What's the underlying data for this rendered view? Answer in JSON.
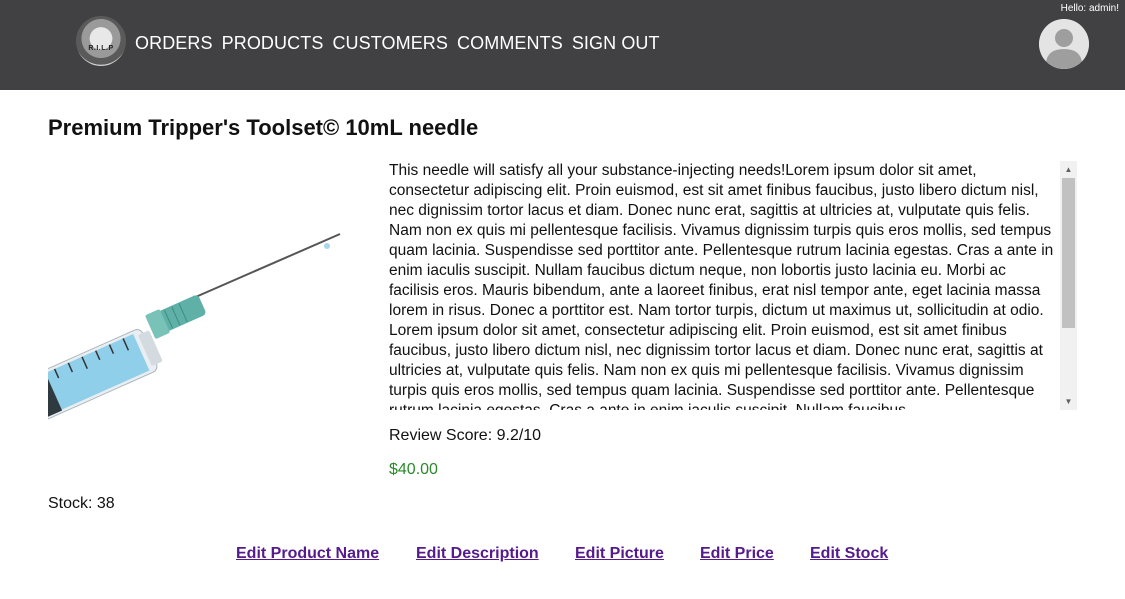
{
  "nav": {
    "logo_text": "R.I.L.P",
    "links": [
      "ORDERS",
      "PRODUCTS",
      "CUSTOMERS",
      "COMMENTS",
      "SIGN OUT"
    ],
    "greeting": "Hello: admin!"
  },
  "product": {
    "title": "Premium Tripper's Toolset© 10mL needle",
    "image_alt": "syringe-needle",
    "description": "This needle will satisfy all your substance-injecting needs!Lorem ipsum dolor sit amet, consectetur adipiscing elit. Proin euismod, est sit amet finibus faucibus, justo libero dictum nisl, nec dignissim tortor lacus et diam. Donec nunc erat, sagittis at ultricies at, vulputate quis felis. Nam non ex quis mi pellentesque facilisis. Vivamus dignissim turpis quis eros mollis, sed tempus quam lacinia. Suspendisse sed porttitor ante. Pellentesque rutrum lacinia egestas. Cras a ante in enim iaculis suscipit. Nullam faucibus dictum neque, non lobortis justo lacinia eu. Morbi ac facilisis eros. Mauris bibendum, ante a laoreet finibus, erat nisl tempor ante, eget lacinia massa lorem in risus. Donec a porttitor est. Nam tortor turpis, dictum ut maximus ut, sollicitudin at odio. Lorem ipsum dolor sit amet, consectetur adipiscing elit. Proin euismod, est sit amet finibus faucibus, justo libero dictum nisl, nec dignissim tortor lacus et diam. Donec nunc erat, sagittis at ultricies at, vulputate quis felis. Nam non ex quis mi pellentesque facilisis. Vivamus dignissim turpis quis eros mollis, sed tempus quam lacinia. Suspendisse sed porttitor ante. Pellentesque rutrum lacinia egestas. Cras a ante in enim iaculis suscipit. Nullam faucibus",
    "review_score": "Review Score: 9.2/10",
    "price": "$40.00",
    "stock": "Stock: 38"
  },
  "edit_links": {
    "name": "Edit Product Name",
    "description": "Edit Description",
    "picture": "Edit Picture",
    "price": "Edit Price",
    "stock": "Edit Stock"
  },
  "colors": {
    "navbar_bg": "#414143",
    "price_green": "#2a8a2a",
    "link_purple": "#551a8b"
  }
}
